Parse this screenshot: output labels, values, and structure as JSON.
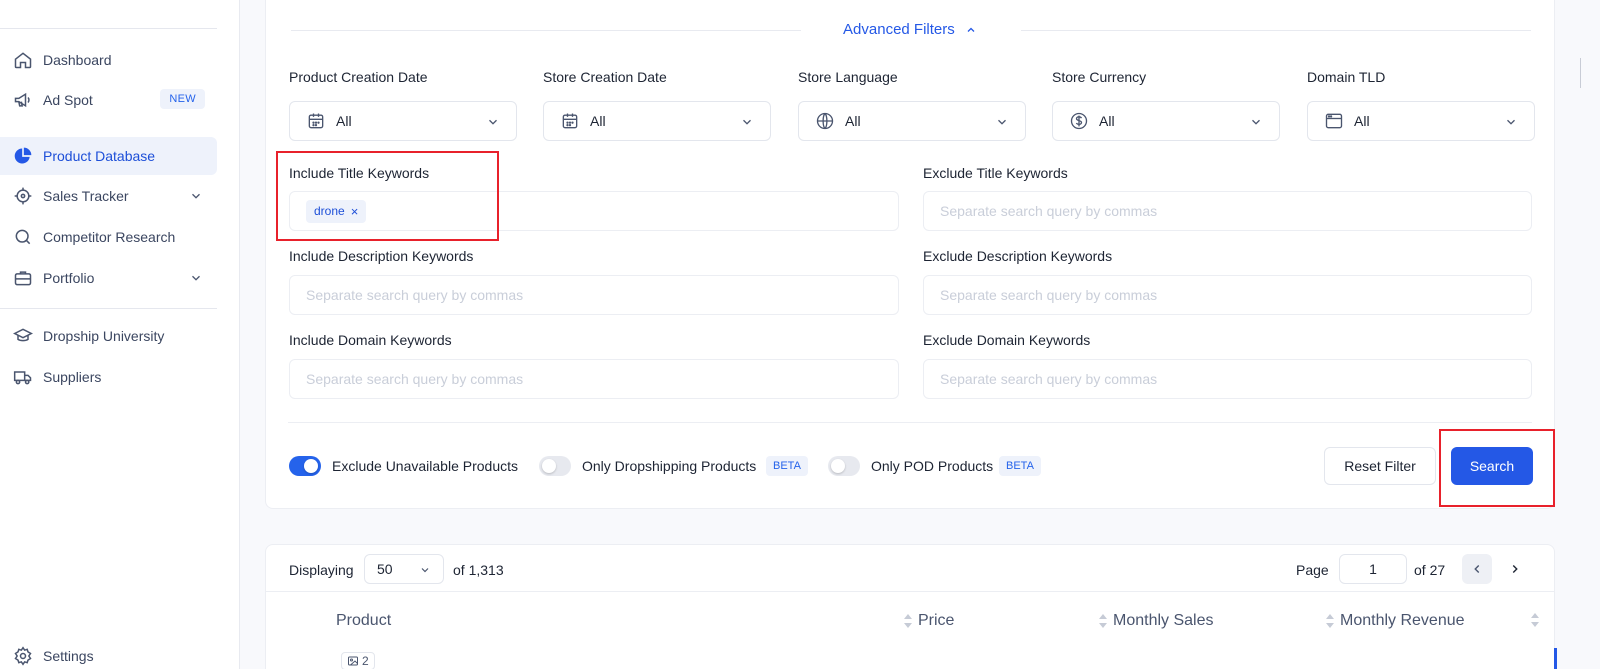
{
  "sidebar": {
    "items": [
      {
        "label": "Dashboard",
        "icon": "home-icon"
      },
      {
        "label": "Ad Spot",
        "icon": "megaphone-icon",
        "badge": "NEW"
      },
      {
        "label": "Product Database",
        "icon": "pie-chart-icon"
      },
      {
        "label": "Sales Tracker",
        "icon": "target-icon"
      },
      {
        "label": "Competitor Research",
        "icon": "search-icon"
      },
      {
        "label": "Portfolio",
        "icon": "briefcase-icon"
      },
      {
        "label": "Dropship University",
        "icon": "graduation-cap-icon"
      },
      {
        "label": "Suppliers",
        "icon": "truck-icon"
      },
      {
        "label": "Settings",
        "icon": "gear-icon"
      }
    ]
  },
  "filters": {
    "advanced_title": "Advanced Filters",
    "dropdowns": [
      {
        "label": "Product Creation Date",
        "value": "All",
        "icon": "calendar-icon"
      },
      {
        "label": "Store Creation Date",
        "value": "All",
        "icon": "calendar-icon"
      },
      {
        "label": "Store Language",
        "value": "All",
        "icon": "globe-icon"
      },
      {
        "label": "Store Currency",
        "value": "All",
        "icon": "dollar-circle-icon"
      },
      {
        "label": "Domain TLD",
        "value": "All",
        "icon": "browser-window-icon"
      }
    ],
    "keywords": {
      "include_title": {
        "label": "Include Title Keywords",
        "tags": [
          "drone"
        ]
      },
      "exclude_title": {
        "label": "Exclude Title Keywords",
        "placeholder": "Separate search query by commas"
      },
      "include_desc": {
        "label": "Include Description Keywords",
        "placeholder": "Separate search query by commas"
      },
      "exclude_desc": {
        "label": "Exclude Description Keywords",
        "placeholder": "Separate search query by commas"
      },
      "include_domain": {
        "label": "Include Domain Keywords",
        "placeholder": "Separate search query by commas"
      },
      "exclude_domain": {
        "label": "Exclude Domain Keywords",
        "placeholder": "Separate search query by commas"
      }
    },
    "toggles": [
      {
        "label": "Exclude Unavailable Products",
        "on": true
      },
      {
        "label": "Only Dropshipping Products",
        "on": false,
        "badge": "BETA"
      },
      {
        "label": "Only POD Products",
        "on": false,
        "badge": "BETA"
      }
    ],
    "reset_label": "Reset Filter",
    "search_label": "Search"
  },
  "table": {
    "displaying_label": "Displaying",
    "per_page": "50",
    "total": "of 1,313",
    "page_label": "Page",
    "page": "1",
    "page_total": "of 27",
    "columns": [
      "Product",
      "Price",
      "Monthly Sales",
      "Monthly Revenue"
    ],
    "first_row_image_count": "2"
  },
  "colors": {
    "accent": "#2458e6",
    "highlight": "#e8212b"
  }
}
